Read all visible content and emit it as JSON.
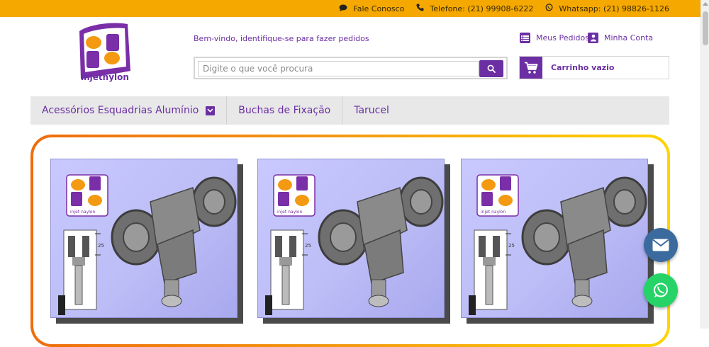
{
  "topbar": {
    "contact": "Fale Conosco",
    "phone": "Telefone: (21) 99908-6222",
    "whatsapp": "Whatsapp: (21) 98826-1126"
  },
  "logo": {
    "text": "injetnylon"
  },
  "header": {
    "welcome": "Bem-vindo, identifique-se para fazer pedidos",
    "orders": "Meus Pedidos",
    "account": "Minha Conta",
    "cart": "Carrinho vazio"
  },
  "search": {
    "placeholder": "Digite o que você procura"
  },
  "nav": {
    "items": [
      {
        "label": "Acessórios Esquadrias Alumínio"
      },
      {
        "label": "Buchas de Fixação"
      },
      {
        "label": "Tarucel"
      }
    ]
  },
  "product": {
    "logo_text": "injet naylon",
    "dimension_label": "25"
  },
  "colors": {
    "brand_purple": "#6b2fa3",
    "topbar_orange": "#f5a800",
    "whatsapp_green": "#25d366",
    "mail_blue": "#3a6a9e"
  }
}
